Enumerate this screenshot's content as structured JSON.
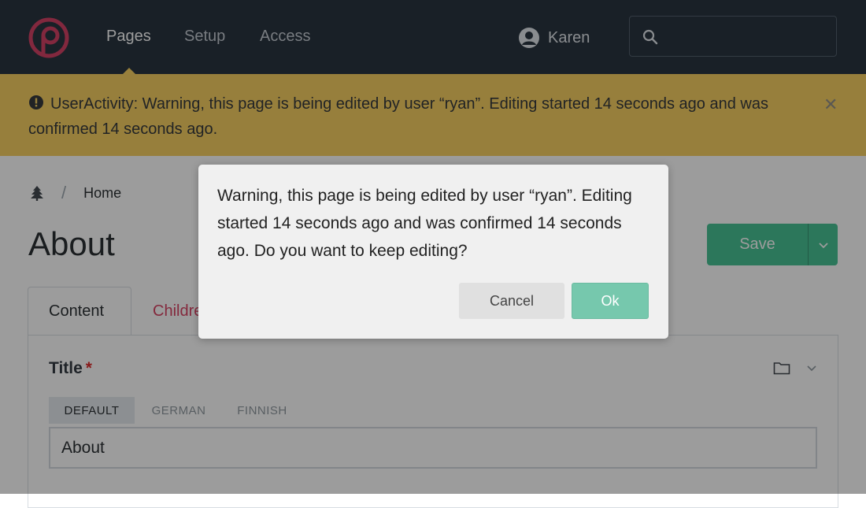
{
  "topbar": {
    "nav": [
      {
        "label": "Pages",
        "active": true
      },
      {
        "label": "Setup",
        "active": false
      },
      {
        "label": "Access",
        "active": false
      }
    ],
    "user_name": "Karen",
    "search_value": ""
  },
  "banner": {
    "message": "UserActivity: Warning, this page is being edited by user “ryan”. Editing started 14 seconds ago and was confirmed 14 seconds ago.",
    "close_symbol": "✕"
  },
  "breadcrumb": {
    "separator": "/",
    "current": "Home"
  },
  "page": {
    "title": "About",
    "save_label": "Save"
  },
  "tabs": [
    {
      "label": "Content"
    },
    {
      "label": "Children"
    }
  ],
  "field": {
    "label": "Title",
    "required_mark": "*",
    "languages": [
      "DEFAULT",
      "GERMAN",
      "FINNISH"
    ],
    "value": "About"
  },
  "dialog": {
    "message": "Warning, this page is being edited by user “ryan”. Editing started 14 seconds ago and was confirmed 14 seconds ago. Do you want to keep editing?",
    "cancel_label": "Cancel",
    "ok_label": "Ok"
  },
  "colors": {
    "topbar": "#1e2a36",
    "banner": "#f7cd5b",
    "accent_green": "#3fbf8f",
    "brand_red": "#c2264b"
  }
}
